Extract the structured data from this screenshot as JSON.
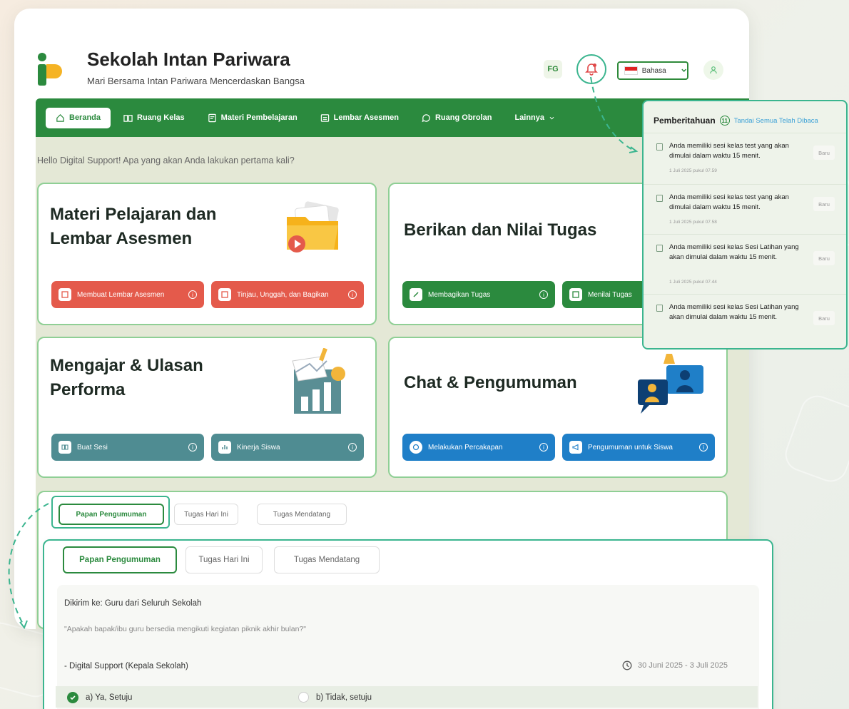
{
  "app": {
    "title": "Sekolah Intan Pariwara",
    "subtitle": "Mari Bersama Intan Pariwara Mencerdaskan Bangsa",
    "fg_label": "FG",
    "language_label": "Bahasa"
  },
  "nav": {
    "items": [
      {
        "label": "Beranda",
        "icon": "home-icon",
        "active": true
      },
      {
        "label": "Ruang Kelas",
        "icon": "book-icon",
        "active": false
      },
      {
        "label": "Materi Pembelajaran",
        "icon": "file-icon",
        "active": false
      },
      {
        "label": "Lembar Asesmen",
        "icon": "sheet-icon",
        "active": false
      },
      {
        "label": "Ruang Obrolan",
        "icon": "chat-icon",
        "active": false
      },
      {
        "label": "Lainnya",
        "icon": "chevron-down-icon",
        "active": false
      }
    ]
  },
  "greeting": "Hello Digital Support! Apa yang akan Anda lakukan pertama kali?",
  "cards": {
    "materi": {
      "title_line1": "Materi Pelajaran dan",
      "title_line2": "Lembar Asesmen",
      "btn1": "Membuat Lembar Asesmen",
      "btn2": "Tinjau, Unggah, dan Bagikan"
    },
    "tugas": {
      "title": "Berikan dan Nilai Tugas",
      "btn1": "Membagikan Tugas",
      "btn2": "Menilai Tugas"
    },
    "mengajar": {
      "title_line1": "Mengajar & Ulasan",
      "title_line2": "Performa",
      "btn1": "Buat Sesi",
      "btn2": "Kinerja Siswa"
    },
    "chat": {
      "title": "Chat & Pengumuman",
      "btn1": "Melakukan Percakapan",
      "btn2": "Pengumuman untuk Siswa"
    }
  },
  "tabs": [
    "Papan Pengumuman",
    "Tugas Hari Ini",
    "Tugas Mendatang"
  ],
  "notifications": {
    "title": "Pemberitahuan",
    "count": "11",
    "mark_all": "Tandai Semua Telah Dibaca",
    "badge": "Baru",
    "items": [
      {
        "text": "Anda memiliki sesi kelas test yang akan dimulai dalam waktu 15 menit.",
        "time": "1 Juli 2025 pukul 07.59"
      },
      {
        "text": "Anda memiliki sesi kelas test yang akan dimulai dalam waktu 15 menit.",
        "time": "1 Juli 2025 pukul 07.58"
      },
      {
        "text": "Anda memiliki sesi kelas Sesi Latihan yang akan dimulai dalam waktu 15 menit.",
        "time": "1 Juli 2025 pukul 07.44"
      },
      {
        "text": "Anda memiliki sesi kelas Sesi Latihan yang akan dimulai dalam waktu 15 menit.",
        "time": ""
      }
    ]
  },
  "announcement": {
    "sent_to": "Dikirim ke: Guru dari Seluruh Sekolah",
    "question": "\"Apakah bapak/ibu guru bersedia mengikuti kegiatan piknik akhir bulan?\"",
    "author": "- Digital Support (Kepala Sekolah)",
    "date_range": "30 Juni 2025 - 3 Juli 2025",
    "option_a": "a) Ya, Setuju",
    "option_b": "b) Tidak, setuju"
  },
  "colors": {
    "primary_green": "#2b8a3e",
    "accent_teal": "#3bb58f",
    "red": "#e45a4b",
    "teal_btn": "#4f8c92",
    "blue": "#1f7fc8"
  }
}
